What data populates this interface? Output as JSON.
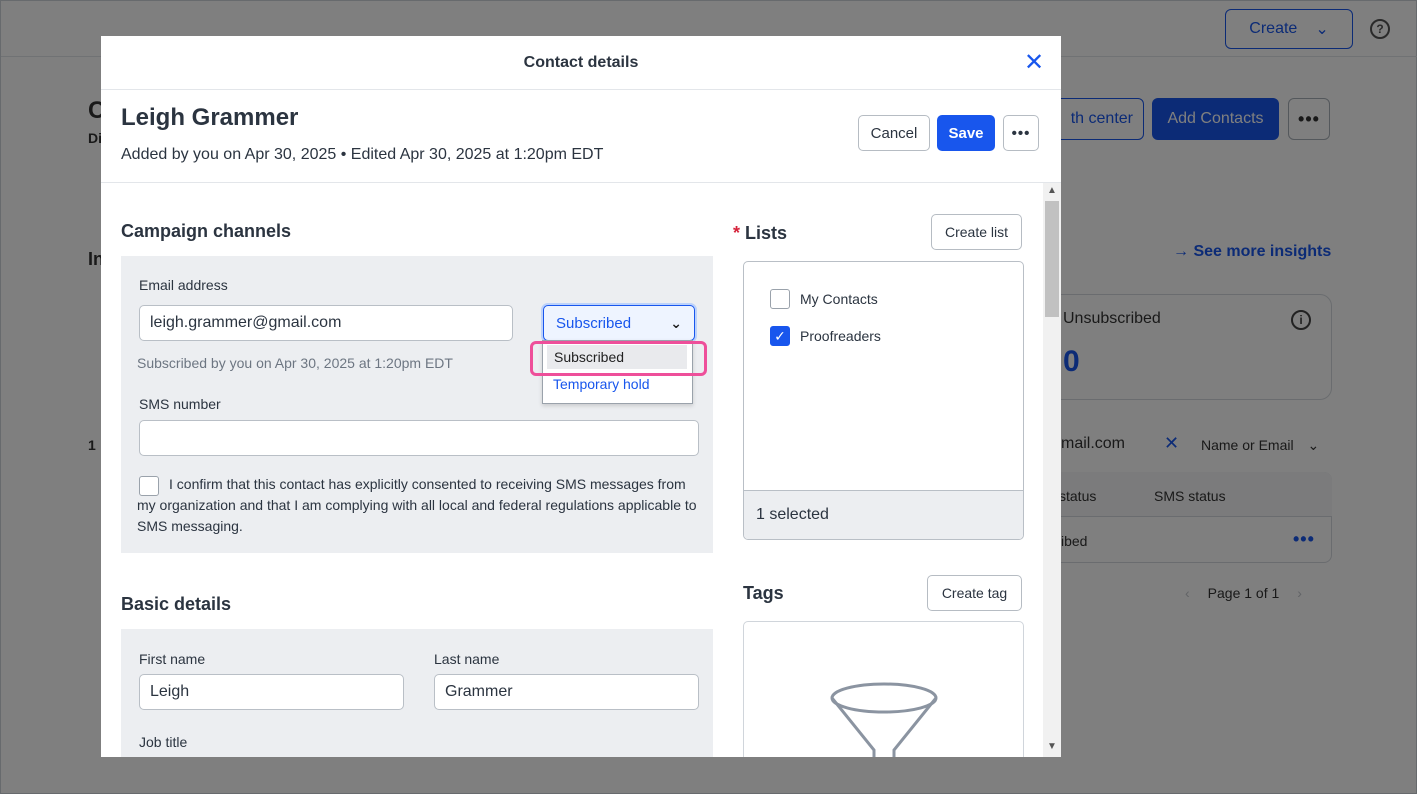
{
  "background": {
    "create_label": "Create",
    "help_icon": "?",
    "growth_label": "th center",
    "add_contacts_label": "Add Contacts",
    "more_label": "•••",
    "see_more_insights": "→ See more insights",
    "unsubscribed_label": "Unsubscribed",
    "info_icon": "i",
    "unsubscribed_count": "0",
    "search_value": "mail.com",
    "search_clear": "✕",
    "search_filter": "Name or Email",
    "col_email_status": "status",
    "col_sms_status": "SMS status",
    "row_status": "ibed",
    "row_more": "•••",
    "pager_text": "Page 1 of 1",
    "left_c": "C",
    "left_di": "Di",
    "left_in": "In",
    "left_1": "1"
  },
  "modal": {
    "title": "Contact details",
    "close_icon": "✕",
    "contact_name": "Leigh Grammer",
    "contact_meta": "Added by you on Apr 30, 2025 • Edited Apr 30, 2025 at 1:20pm EDT",
    "cancel_label": "Cancel",
    "save_label": "Save",
    "more_label": "•••"
  },
  "campaign_channels": {
    "title": "Campaign channels",
    "email_label": "Email address",
    "email_value": "leigh.grammer@gmail.com",
    "status_selected": "Subscribed",
    "status_options": [
      "Subscribed",
      "Temporary hold"
    ],
    "subscribed_hint": "Subscribed by you on Apr 30, 2025 at 1:20pm EDT",
    "sms_label": "SMS number",
    "sms_value": "",
    "consent_text": "I confirm that this contact has explicitly consented to receiving SMS messages from my organization and that I am complying with all local and federal regulations applicable to SMS messaging."
  },
  "basic_details": {
    "title": "Basic details",
    "first_name_label": "First name",
    "first_name_value": "Leigh",
    "last_name_label": "Last name",
    "last_name_value": "Grammer",
    "job_title_label": "Job title"
  },
  "lists": {
    "required_mark": "*",
    "title": "Lists",
    "create_label": "Create list",
    "items": [
      {
        "label": "My Contacts",
        "checked": false
      },
      {
        "label": "Proofreaders",
        "checked": true
      }
    ],
    "selected_summary": "1 selected"
  },
  "tags": {
    "title": "Tags",
    "create_label": "Create tag"
  },
  "colors": {
    "accent": "#1856ed",
    "highlight": "#ee4f9a"
  }
}
